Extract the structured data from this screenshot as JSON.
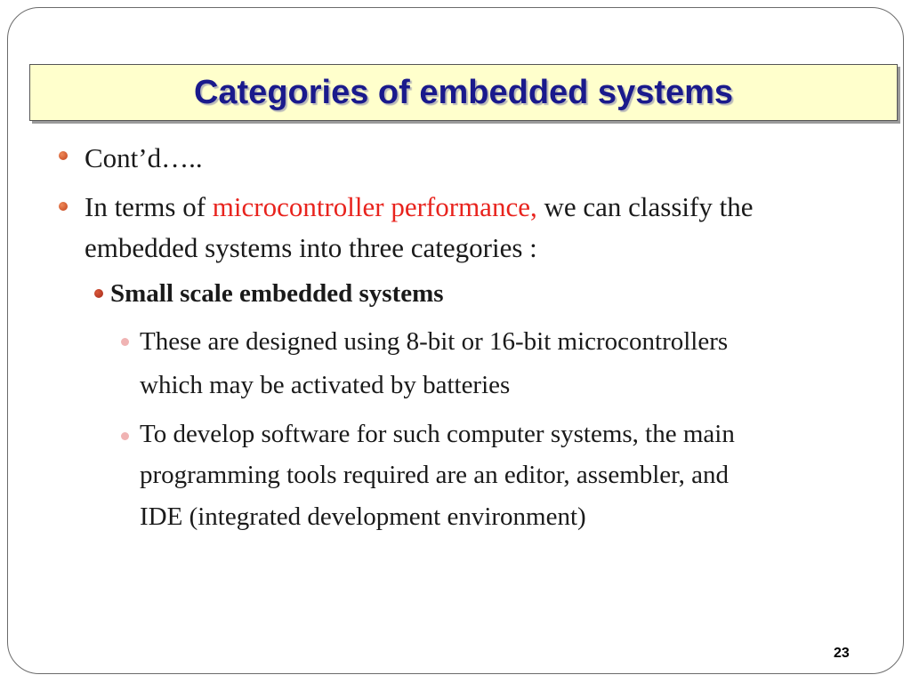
{
  "title": "Categories of embedded systems",
  "bullets": {
    "b1": "Cont’d…..",
    "b2_pre": "In terms of ",
    "b2_highlight": "microcontroller performance,",
    "b2_post": " we can classify the",
    "b2_line2": "embedded systems into three categories :",
    "sub1": "Small scale embedded systems",
    "sub1_p1_line1": "These are designed using 8-bit or 16-bit microcontrollers",
    "sub1_p1_line2": "which may be activated by batteries",
    "sub1_p2_line1": "To develop software for such computer systems, the main",
    "sub1_p2_line2": "programming tools required are an editor, assembler, and",
    "sub1_p2_line3": "IDE (integrated development environment)"
  },
  "page_number": "23",
  "colors": {
    "title": "#1a1a8c",
    "title_bg": "#ffffcc",
    "highlight": "#e8231d"
  }
}
